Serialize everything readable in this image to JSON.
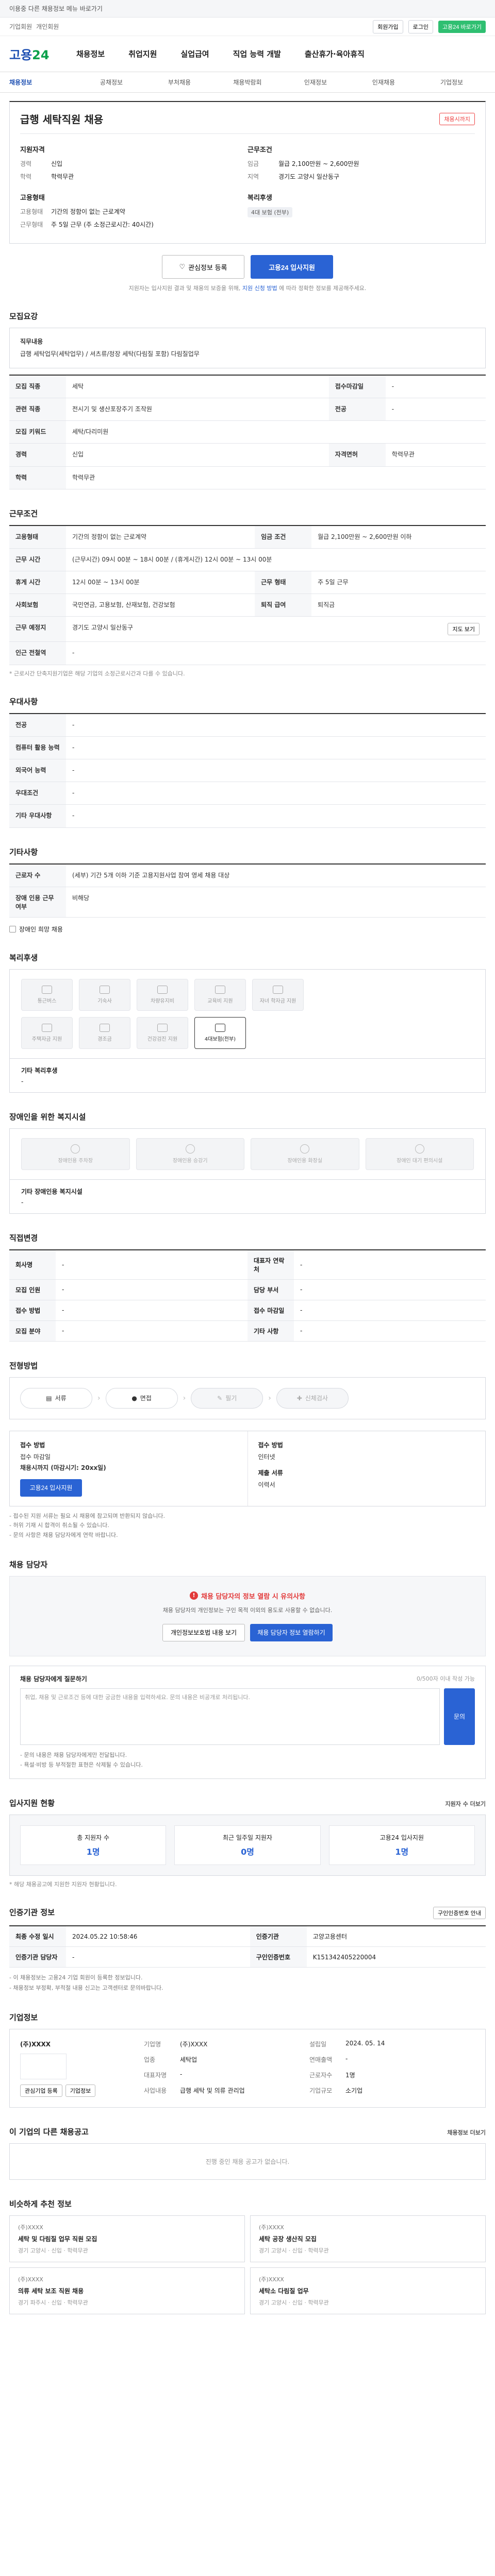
{
  "topbar": {
    "notice": "이용중 다른 채용정보 메뉴 바로가기",
    "sub": "고용24 홈"
  },
  "gnb": {
    "left": [
      "기업회원",
      "개인회원"
    ],
    "btn1": "회원가입",
    "btn2": "로그인",
    "btn3": "고용24 바로가기"
  },
  "logo": {
    "main": "고용",
    "accent": "24"
  },
  "nav": [
    "채용정보",
    "취업지원",
    "실업급여",
    "직업 능력 개발",
    "출산휴가·육아휴직"
  ],
  "subnav": [
    "채용정보",
    "공채정보",
    "부처채용",
    "채용박람회",
    "인재정보",
    "인재채용",
    "기업정보"
  ],
  "job": {
    "title": "급행 세탁직원 채용",
    "badge": "채용시까지",
    "company_h": "지원자격",
    "rows_left": [
      {
        "k": "경력",
        "v": "신입"
      },
      {
        "k": "학력",
        "v": "학력무관"
      }
    ],
    "cond_h": "근무조건",
    "rows_right": [
      {
        "k": "임금",
        "v": "월급 2,100만원 ~ 2,600만원"
      },
      {
        "k": "지역",
        "v": "경기도 고양시 일산동구"
      }
    ],
    "type_h": "고용형태",
    "rows_left2": [
      {
        "k": "고용형태",
        "v": "기간의 정함이 없는 근로계약"
      },
      {
        "k": "근무형태",
        "v": "주 5일 근무 (주 소정근로시간: 40시간)"
      }
    ],
    "welfare_h": "복리후생",
    "welfare_tag": "4대 보험 (전부)"
  },
  "apply": {
    "save": "관심정보 등록",
    "apply": "고용24 입사지원",
    "note_a": "지원자는 입사지원 결과 및 채용의 보증을 위해,",
    "note_b": "지원 신청 방법",
    "note_c": "에 따라 정확한 정보를 제공해주세요."
  },
  "detail": {
    "title": "모집요강",
    "job_desc_label": "직무내용",
    "job_desc": "급행 세탁업무(세탁업무) / 셔츠류/정장 세탁(다림질 포함) 다림질업무",
    "rows": [
      {
        "k": "모집 직종",
        "v": "세탁"
      },
      {
        "k": "관련 직종",
        "v": "전시기 및 생산포장주기 조작원"
      },
      {
        "k": "모집 키워드",
        "v": "세탁/다리미원"
      },
      {
        "k": "경력",
        "v": "신입"
      },
      {
        "k": "학력",
        "v": "학력무관"
      }
    ],
    "rows_r": [
      {
        "k": "접수마감일",
        "v": "-"
      },
      {
        "k": "전공",
        "v": "-"
      },
      {
        "k": "자격면허",
        "v": "학력무관"
      }
    ]
  },
  "cond": {
    "title": "근무조건",
    "rows": [
      {
        "k": "고용형태",
        "v": "기간의 정함이 없는 근로계약"
      },
      {
        "k": "근무 예정지",
        "v": "경기도 고양시 일산동구 / 지하철 없음"
      },
      {
        "k": "근무 시간",
        "v": "(근무시간) 09시 00분 ~ 18시 00분 / (휴게시간) 12시 00분 ~ 13시 00분"
      },
      {
        "k": "휴게 시간",
        "v": "12시 00분 ~ 13시 00분"
      },
      {
        "k": "사회보험",
        "v": "국민연금, 고용보험, 산재보험, 건강보험"
      },
      {
        "k": "근무 예정지",
        "v": "경기도 고양시 일산동구 "
      },
      {
        "k": "인근 전철역",
        "v": "-"
      },
      {
        "k": "퇴직 급여",
        "v": "퇴직금"
      }
    ],
    "pay": "월급 2,100만원 ~ 2,600만원 이하",
    "week": "주 5일 근무",
    "map_btn": "지도 보기",
    "note": "* 근로시간 단축지원기업은 해당 기업의 소정근로시간과 다를 수 있습니다."
  },
  "pref": {
    "title": "우대사항",
    "rows": [
      {
        "k": "전공",
        "v": "-"
      },
      {
        "k": "컴퓨터 활용 능력",
        "v": "-"
      },
      {
        "k": "외국어 능력",
        "v": "-"
      },
      {
        "k": "우대조건",
        "v": "-"
      },
      {
        "k": "기타 우대사항",
        "v": "-"
      }
    ]
  },
  "etc": {
    "title": "기타사항",
    "rows": [
      {
        "k": "근로자 수",
        "v": "(세부) 기간 5개 이하 기준 고용지원사업 참여 영세 채용 대상"
      },
      {
        "k": "장애 인용 근무 여부",
        "v": "비해당"
      }
    ],
    "check": "장애인 희망 채용"
  },
  "welfare": {
    "title": "복리후생",
    "items": [
      "통근버스",
      "기숙사",
      "차량유지비",
      "교육비 지원",
      "자녀 학자금 지원",
      "주택자금 지원",
      "경조금",
      "건강검진 지원",
      "4대보험(전부)"
    ],
    "on_index": 8,
    "etc_label": "기타 복리후생",
    "etc_value": "-"
  },
  "disability": {
    "title": "장애인을 위한 복지시설",
    "items": [
      "장애인용 주차장",
      "장애인용 승강기",
      "장애인용 화장실",
      "장애인 대기 편의시설"
    ],
    "etc_label": "기타 장애인용 복지시설",
    "etc_value": "-"
  },
  "worker": {
    "title": "직접변경",
    "rows": [
      {
        "k": "회사명",
        "v": "-"
      },
      {
        "k": "모집 인원",
        "v": "-"
      },
      {
        "k": "접수 방법",
        "v": "-"
      },
      {
        "k": "모집 분야",
        "v": "-"
      }
    ],
    "rows_r": [
      {
        "k": "대표자 연락처",
        "v": "-"
      },
      {
        "k": "담당 부서",
        "v": "-"
      },
      {
        "k": "접수 마감일",
        "v": "-"
      },
      {
        "k": "기타 사항",
        "v": "-"
      }
    ]
  },
  "process": {
    "title": "전형방법",
    "steps": [
      "서류",
      "면접",
      "필기",
      "신체검사"
    ]
  },
  "applyinfo": {
    "title": "접수 방법",
    "sub_k": "접수 마감일",
    "sub_v": "채용시까지 (마감시기: 20xx일)",
    "btn": "고용24 입사지원",
    "k2": "접수 방법",
    "v2": "인터넷",
    "k3": "제출 서류",
    "v3": "이력서",
    "notes": [
      "- 접수된 지원 서류는 필요 시 채용에 참고되며 반환되지 않습니다.",
      "- 허위 기재 시 합격이 취소될 수 있습니다.",
      "- 문의 사항은 채용 담당자에게 연락 바랍니다."
    ]
  },
  "contact": {
    "title": "채용 담당자",
    "warn": "채용 담당자의 정보 열람 시 유의사항",
    "desc": "채용 담당자의 개인정보는 구인 목적 이외의 용도로 사용할 수 없습니다.",
    "btn_a": "개인정보보호법 내용 보기",
    "btn_b": "채용 담당자 정보 열람하기"
  },
  "inquiry": {
    "title": "채용 담당자에게 질문하기",
    "counter": "0/500자 이내 작성 가능",
    "placeholder": "취업, 채용 및 근로조건 등에 대한 궁금한 내용을 입력하세요. 문의 내용은 비공개로 처리됩니다.",
    "btn": "문의",
    "notes": [
      "- 문의 내용은 채용 담당자에게만 전달됩니다.",
      "- 욕설·비방 등 부적절한 표현은 삭제될 수 있습니다."
    ]
  },
  "status": {
    "title": "입사지원 현황",
    "more": "지원자 수 더보기",
    "items": [
      {
        "k": "총 지원자 수",
        "v": "1명"
      },
      {
        "k": "최근 일주일 지원자",
        "v": "0명"
      },
      {
        "k": "고용24 입사지원",
        "v": "1명"
      }
    ],
    "note": "* 해당 채용공고에 지원한 지원자 현황입니다."
  },
  "source": {
    "title": "인증기관 정보",
    "btn": "구인인증번호 안내",
    "rows": [
      {
        "k": "최종 수정 일시",
        "v": "2024.05.22 10:58:46"
      },
      {
        "k": "인증기관",
        "v": "고양고용센터"
      },
      {
        "k": "인증기관 담당자",
        "v": "-"
      }
    ],
    "rows_r": [
      {
        "k": "인증기관",
        "v": "고양고용센터"
      },
      {
        "k": "구인인증번호",
        "v": "K151342405220004"
      }
    ],
    "notes": [
      "- 이 채용정보는 고용24 기업 회원이 등록한 정보입니다.",
      "- 채용정보 부정확, 부적절 내용 신고는 고객센터로 문의바랍니다."
    ]
  },
  "company": {
    "title": "기업정보",
    "name": "(주)XXXX",
    "btn1": "관심기업 등록",
    "btn2": "기업정보",
    "rows": [
      {
        "k": "기업명",
        "v": "(주)XXXX"
      },
      {
        "k": "업종",
        "v": "세탁업"
      },
      {
        "k": "대표자명",
        "v": "-"
      },
      {
        "k": "사업내용",
        "v": "급행 세탁 및 의류 관리업"
      }
    ],
    "rows_r": [
      {
        "k": "설립일",
        "v": "2024. 05. 14"
      },
      {
        "k": "연매출액",
        "v": "-"
      },
      {
        "k": "근로자수",
        "v": "1명"
      },
      {
        "k": "기업규모",
        "v": "소기업"
      }
    ]
  },
  "other": {
    "title": "이 기업의 다른 채용공고",
    "more": "채용정보 더보기",
    "empty": "진행 중인 채용 공고가 없습니다."
  },
  "rec": {
    "title": "비슷하게 추천 정보",
    "items": [
      {
        "co": "(주)XXXX",
        "t": "세탁 및 다림질 업무 직원 모집",
        "meta": "경기 고양시 · 신입 · 학력무관"
      },
      {
        "co": "(주)XXXX",
        "t": "세탁 공장 생산직 모집",
        "meta": "경기 고양시 · 신입 · 학력무관"
      },
      {
        "co": "(주)XXXX",
        "t": "의류 세탁 보조 직원 채용",
        "meta": "경기 파주시 · 신입 · 학력무관"
      },
      {
        "co": "(주)XXXX",
        "t": "세탁소 다림질 업무",
        "meta": "경기 고양시 · 신입 · 학력무관"
      }
    ]
  }
}
